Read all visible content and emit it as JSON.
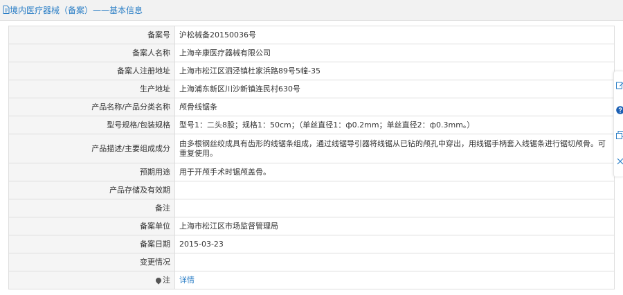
{
  "header": {
    "title": "境内医疗器械（备案）——基本信息",
    "icon": "document-icon"
  },
  "rows": [
    {
      "label": "备案号",
      "value": "沪松械备20150036号"
    },
    {
      "label": "备案人名称",
      "value": "上海辛康医疗器械有限公司"
    },
    {
      "label": "备案人注册地址",
      "value": "上海市松江区泗泾镇杜家浜路89号5幢-35"
    },
    {
      "label": "生产地址",
      "value": "上海浦东新区川沙新镇连民村630号"
    },
    {
      "label": "产品名称/产品分类名称",
      "value": "颅骨线锯条"
    },
    {
      "label": "型号规格/包装规格",
      "value": "型号1：二头8股；规格1：50cm；（单丝直径1：ф0.2mm；单丝直径2：ф0.3mm。）"
    },
    {
      "label": "产品描述/主要组成成分",
      "value": "由多根钢丝绞成具有齿形的线锯条组成，通过线锯导引器将线锯从已钻的颅孔中穿出，用线锯手柄套入线锯条进行锯切颅骨。可重复使用。"
    },
    {
      "label": "预期用途",
      "value": "用于开颅手术时锯颅盖骨。"
    },
    {
      "label": "产品存储及有效期",
      "value": ""
    },
    {
      "label": "备注",
      "value": ""
    },
    {
      "label": "备案单位",
      "value": "上海市松江区市场监督管理局"
    },
    {
      "label": "备案日期",
      "value": "2015-03-23"
    },
    {
      "label": "变更情况",
      "value": ""
    },
    {
      "label": "注",
      "value": "详情"
    }
  ],
  "side_toolbar": {
    "icons": [
      "edit-icon",
      "help-icon",
      "copy-icon",
      "close-icon"
    ]
  },
  "colors": {
    "accent": "#2a7ec6",
    "label_bg": "#f5f5f5",
    "border": "#dddddd",
    "help_icon": "#1a5fb4"
  }
}
